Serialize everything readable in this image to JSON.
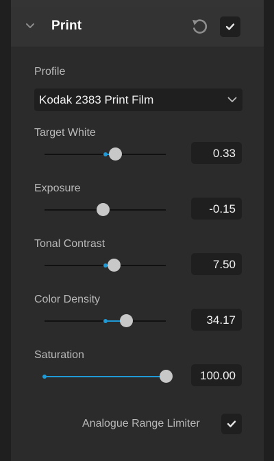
{
  "panel": {
    "title": "Print",
    "icons": {
      "collapse": "chevron-down-icon",
      "reset": "reset-icon",
      "enable": "check-icon"
    },
    "enabled": true
  },
  "profile": {
    "label": "Profile",
    "value": "Kodak 2383 Print Film"
  },
  "sliders": [
    {
      "label": "Target White",
      "value": "0.33",
      "position": 0.58,
      "default": 0.5
    },
    {
      "label": "Exposure",
      "value": "-0.15",
      "position": 0.48,
      "default": 0.48
    },
    {
      "label": "Tonal Contrast",
      "value": "7.50",
      "position": 0.57,
      "default": 0.5
    },
    {
      "label": "Color Density",
      "value": "34.17",
      "position": 0.67,
      "default": 0.5
    },
    {
      "label": "Saturation",
      "value": "100.00",
      "position": 1.0,
      "default": 0.0
    }
  ],
  "analogue_range_limiter": {
    "label": "Analogue Range Limiter",
    "checked": true
  },
  "colors": {
    "accent": "#1f9ad6",
    "panel_bg": "#2b2b2b",
    "field_bg": "#1f1f1f",
    "thumb": "#c8c8c8"
  }
}
